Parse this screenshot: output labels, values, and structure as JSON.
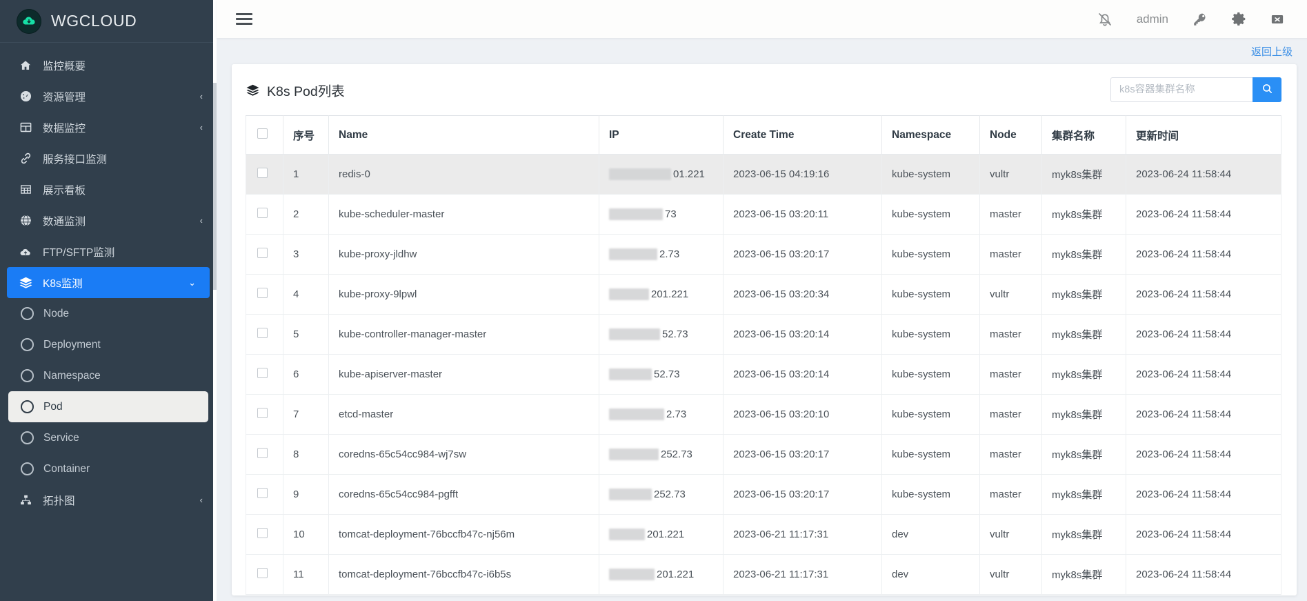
{
  "brand": {
    "name": "WGCLOUD",
    "logo_icon": "cloud-download-icon"
  },
  "sidebar": {
    "items": [
      {
        "label": "监控概要",
        "icon": "home-icon",
        "chevron": "",
        "type": "top"
      },
      {
        "label": "资源管理",
        "icon": "dashboard-icon",
        "chevron": "‹",
        "type": "top"
      },
      {
        "label": "数据监控",
        "icon": "table-icon",
        "chevron": "‹",
        "type": "top"
      },
      {
        "label": "服务接口监测",
        "icon": "link-icon",
        "chevron": "",
        "type": "top"
      },
      {
        "label": "展示看板",
        "icon": "grid-icon",
        "chevron": "",
        "type": "top"
      },
      {
        "label": "数通监测",
        "icon": "globe-icon",
        "chevron": "‹",
        "type": "top"
      },
      {
        "label": "FTP/SFTP监测",
        "icon": "cloud-upload-icon",
        "chevron": "",
        "type": "top"
      },
      {
        "label": "K8s监测",
        "icon": "layers-icon",
        "chevron": "⌄",
        "type": "top",
        "active": true
      },
      {
        "label": "Node",
        "icon": "circle-icon",
        "type": "sub"
      },
      {
        "label": "Deployment",
        "icon": "circle-icon",
        "type": "sub"
      },
      {
        "label": "Namespace",
        "icon": "circle-icon",
        "type": "sub"
      },
      {
        "label": "Pod",
        "icon": "circle-icon",
        "type": "sub",
        "selected": true
      },
      {
        "label": "Service",
        "icon": "circle-icon",
        "type": "sub"
      },
      {
        "label": "Container",
        "icon": "circle-icon",
        "type": "sub"
      },
      {
        "label": "拓扑图",
        "icon": "sitemap-icon",
        "chevron": "‹",
        "type": "top"
      }
    ]
  },
  "topbar": {
    "menu_toggle": "hamburger-icon",
    "bell_icon": "bell-off-icon",
    "user": "admin",
    "key_icon": "key-icon",
    "gear_icon": "gear-icon",
    "exit_icon": "exit-icon"
  },
  "page": {
    "back_link": "返回上级",
    "card_title": "K8s Pod列表",
    "card_icon": "layers-icon"
  },
  "search": {
    "placeholder": "k8s容器集群名称",
    "value": "",
    "button_icon": "search-icon"
  },
  "colors": {
    "sidebar_bg": "#313f4c",
    "accent_blue": "#1a7cf5",
    "search_button": "#2a8ff5",
    "link_blue": "#3a8ee6",
    "page_bg": "#eef1f5",
    "row_highlight": "#ebebeb"
  },
  "table": {
    "columns": [
      "",
      "序号",
      "Name",
      "IP",
      "Create Time",
      "Namespace",
      "Node",
      "集群名称",
      "更新时间"
    ],
    "rows": [
      {
        "idx": "1",
        "name": "redis-0",
        "ip_redacted": true,
        "ip_visible": "01.221",
        "create_time": "2023-06-15 04:19:16",
        "namespace": "kube-system",
        "node": "vultr",
        "cluster": "myk8s集群",
        "update_time": "2023-06-24 11:58:44",
        "highlight": true
      },
      {
        "idx": "2",
        "name": "kube-scheduler-master",
        "ip_redacted": true,
        "ip_visible": "73",
        "create_time": "2023-06-15 03:20:11",
        "namespace": "kube-system",
        "node": "master",
        "cluster": "myk8s集群",
        "update_time": "2023-06-24 11:58:44"
      },
      {
        "idx": "3",
        "name": "kube-proxy-jldhw",
        "ip_redacted": true,
        "ip_visible": "2.73",
        "create_time": "2023-06-15 03:20:17",
        "namespace": "kube-system",
        "node": "master",
        "cluster": "myk8s集群",
        "update_time": "2023-06-24 11:58:44"
      },
      {
        "idx": "4",
        "name": "kube-proxy-9lpwl",
        "ip_redacted": true,
        "ip_visible": "201.221",
        "create_time": "2023-06-15 03:20:34",
        "namespace": "kube-system",
        "node": "vultr",
        "cluster": "myk8s集群",
        "update_time": "2023-06-24 11:58:44"
      },
      {
        "idx": "5",
        "name": "kube-controller-manager-master",
        "ip_redacted": true,
        "ip_visible": "52.73",
        "create_time": "2023-06-15 03:20:14",
        "namespace": "kube-system",
        "node": "master",
        "cluster": "myk8s集群",
        "update_time": "2023-06-24 11:58:44"
      },
      {
        "idx": "6",
        "name": "kube-apiserver-master",
        "ip_redacted": true,
        "ip_visible": "52.73",
        "create_time": "2023-06-15 03:20:14",
        "namespace": "kube-system",
        "node": "master",
        "cluster": "myk8s集群",
        "update_time": "2023-06-24 11:58:44"
      },
      {
        "idx": "7",
        "name": "etcd-master",
        "ip_redacted": true,
        "ip_visible": "2.73",
        "create_time": "2023-06-15 03:20:10",
        "namespace": "kube-system",
        "node": "master",
        "cluster": "myk8s集群",
        "update_time": "2023-06-24 11:58:44"
      },
      {
        "idx": "8",
        "name": "coredns-65c54cc984-wj7sw",
        "ip_redacted": true,
        "ip_visible": "252.73",
        "create_time": "2023-06-15 03:20:17",
        "namespace": "kube-system",
        "node": "master",
        "cluster": "myk8s集群",
        "update_time": "2023-06-24 11:58:44"
      },
      {
        "idx": "9",
        "name": "coredns-65c54cc984-pgfft",
        "ip_redacted": true,
        "ip_visible": "252.73",
        "create_time": "2023-06-15 03:20:17",
        "namespace": "kube-system",
        "node": "master",
        "cluster": "myk8s集群",
        "update_time": "2023-06-24 11:58:44"
      },
      {
        "idx": "10",
        "name": "tomcat-deployment-76bccfb47c-nj56m",
        "ip_redacted": true,
        "ip_visible": "201.221",
        "create_time": "2023-06-21 11:17:31",
        "namespace": "dev",
        "node": "vultr",
        "cluster": "myk8s集群",
        "update_time": "2023-06-24 11:58:44"
      },
      {
        "idx": "11",
        "name": "tomcat-deployment-76bccfb47c-i6b5s",
        "ip_redacted": true,
        "ip_visible": "201.221",
        "create_time": "2023-06-21 11:17:31",
        "namespace": "dev",
        "node": "vultr",
        "cluster": "myk8s集群",
        "update_time": "2023-06-24 11:58:44"
      }
    ]
  }
}
